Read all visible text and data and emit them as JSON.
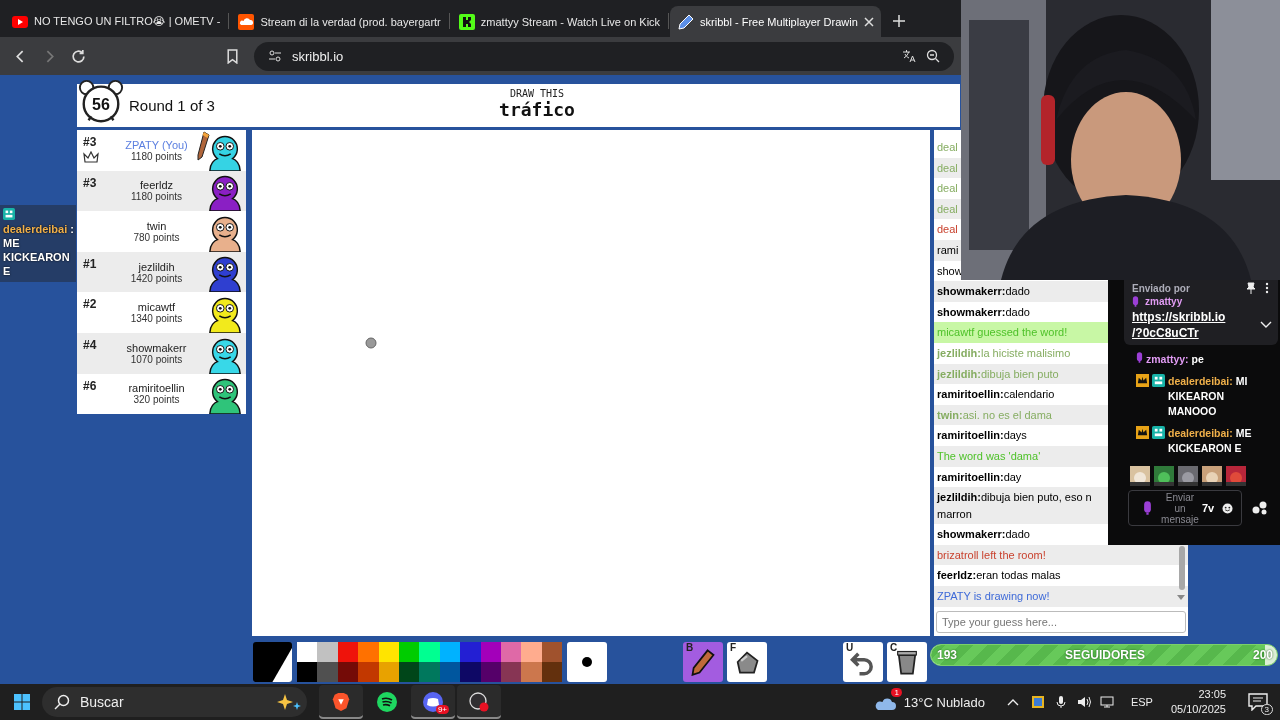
{
  "browser": {
    "tabs": [
      {
        "title": "NO TENGO UN FILTRO😭 | OMETV -",
        "kind": "video",
        "selected": false
      },
      {
        "title": "Stream di la verdad (prod. bayergartr",
        "kind": "audio",
        "selected": false
      },
      {
        "title": "zmattyy Stream - Watch Live on Kick",
        "kind": "stream",
        "selected": false
      },
      {
        "title": "skribbl - Free Multiplayer Drawin",
        "kind": "drawing",
        "selected": true
      }
    ],
    "forward_disabled": true,
    "url": "skribbl.io"
  },
  "game": {
    "timer": "56",
    "round": "Round 1 of 3",
    "prompt_label": "DRAW THIS",
    "word": "tráfico"
  },
  "players": [
    {
      "rank": "#3",
      "name": "ZPATY (You)",
      "points": "1180 points",
      "is_you": true,
      "owner": true,
      "drawing": true,
      "color": "#35d3e4"
    },
    {
      "rank": "#3",
      "name": "feerldz",
      "points": "1180 points",
      "is_you": false,
      "owner": false,
      "drawing": false,
      "color": "#8a1fc4"
    },
    {
      "name": "twin",
      "points": "780 points",
      "is_you": false,
      "owner": false,
      "drawing": false,
      "color": "#e8b08c"
    },
    {
      "rank": "#1",
      "name": "jezlildih",
      "points": "1420 points",
      "is_you": false,
      "owner": false,
      "drawing": false,
      "color": "#2f3fd0"
    },
    {
      "rank": "#2",
      "name": "micawtf",
      "points": "1340 points",
      "is_you": false,
      "owner": false,
      "drawing": false,
      "color": "#f2ea1c"
    },
    {
      "rank": "#4",
      "name": "showmakerr",
      "points": "1070 points",
      "is_you": false,
      "owner": false,
      "drawing": false,
      "color": "#38d8e8"
    },
    {
      "rank": "#6",
      "name": "ramiritoellin",
      "points": "320 points",
      "is_you": false,
      "owner": false,
      "drawing": false,
      "color": "#2fc47a"
    }
  ],
  "chat": {
    "messages": [
      {
        "text": "deal",
        "kind": "guessed",
        "highlight": false
      },
      {
        "text": "deal",
        "kind": "guessed",
        "highlight": false
      },
      {
        "text": "deal",
        "kind": "guessed",
        "highlight": false
      },
      {
        "text": "deal",
        "kind": "guessed",
        "highlight": false
      },
      {
        "text": "deal",
        "kind": "bad",
        "highlight": false
      },
      {
        "text": "rami",
        "kind": "normal",
        "highlight": false
      },
      {
        "text": "show",
        "kind": "normal",
        "highlight": false
      },
      {
        "name": "showmakerr:",
        "text": "dado",
        "kind": "normal",
        "highlight": false
      },
      {
        "name": "showmakerr:",
        "text": "dado",
        "kind": "normal",
        "highlight": false
      },
      {
        "text": "micawtf guessed the word!",
        "kind": "good",
        "highlight": true
      },
      {
        "name": "jezlildih:",
        "text": "la hiciste malisimo",
        "kind": "guessed",
        "highlight": false
      },
      {
        "name": "jezlildih:",
        "text": "dibuja bien puto",
        "kind": "guessed",
        "highlight": false
      },
      {
        "name": "ramiritoellin:",
        "text": "calendario",
        "kind": "normal",
        "highlight": false
      },
      {
        "name": "twin:",
        "text": "asi. no es el dama",
        "kind": "guessed",
        "highlight": false
      },
      {
        "name": "ramiritoellin:",
        "text": "days",
        "kind": "normal",
        "highlight": false
      },
      {
        "text": "The word was 'dama'",
        "kind": "good",
        "highlight": false
      },
      {
        "name": "ramiritoellin:",
        "text": "day",
        "kind": "normal",
        "highlight": false
      },
      {
        "name": "jezlildih:",
        "text": "dibuja bien puto, eso n",
        "continuation": "marron",
        "kind": "normal",
        "highlight": false
      },
      {
        "name": "showmakerr:",
        "text": "dado",
        "kind": "normal",
        "highlight": false
      },
      {
        "text": "brizatroll left the room!",
        "kind": "bad",
        "highlight": false
      },
      {
        "name": "feerldz:",
        "text": "eran todas malas",
        "kind": "normal",
        "highlight": false
      },
      {
        "text": "ZPATY is drawing now!",
        "kind": "info",
        "highlight": false
      }
    ],
    "placeholder": "Type your guess here..."
  },
  "palette": {
    "current": {
      "color": "#000000"
    },
    "colors": [
      {
        "color": "#ffffff"
      },
      {
        "color": "#c1c1c1"
      },
      {
        "color": "#ef130b"
      },
      {
        "color": "#ff7100"
      },
      {
        "color": "#ffe400"
      },
      {
        "color": "#00cc00"
      },
      {
        "color": "#00ff91"
      },
      {
        "color": "#00b2ff"
      },
      {
        "color": "#231fd3"
      },
      {
        "color": "#a300ba"
      },
      {
        "color": "#df69a7"
      },
      {
        "color": "#ffac8e"
      },
      {
        "color": "#a0522d"
      },
      {
        "color": "#000000"
      },
      {
        "color": "#505050"
      },
      {
        "color": "#740b07"
      },
      {
        "color": "#c23800"
      },
      {
        "color": "#e8a200"
      },
      {
        "color": "#004619"
      },
      {
        "color": "#00785d"
      },
      {
        "color": "#00569e"
      },
      {
        "color": "#0e0865"
      },
      {
        "color": "#550069"
      },
      {
        "color": "#873554"
      },
      {
        "color": "#cc774d"
      },
      {
        "color": "#63300d"
      }
    ]
  },
  "tools": [
    {
      "key": "B",
      "kind": "pencil",
      "selected": true
    },
    {
      "key": "F",
      "kind": "fill",
      "selected": false
    },
    {
      "key": "U",
      "kind": "undo",
      "selected": false
    },
    {
      "key": "C",
      "kind": "clear",
      "selected": false
    }
  ],
  "overlay_message": {
    "user": "dealerdeibai",
    "text": ": ME KICKEARON E"
  },
  "stream_chat": {
    "pinned": {
      "header": "Enviado por",
      "user": "zmattyy",
      "color": "#e29cf5",
      "link_lines": [
        "https://skribbl.io",
        "/?0cC8uCTr"
      ]
    },
    "messages": [
      {
        "user": "zmattyy:",
        "text": "pe",
        "color": "#e29cf5",
        "badges": [
          {
            "kind": "mic"
          }
        ]
      },
      {
        "user": "dealerdeibai:",
        "text": "MI KIKEARON MANOOO",
        "color": "#f0b04a",
        "badges": [
          {
            "kind": "crown"
          },
          {
            "kind": "team"
          }
        ]
      },
      {
        "user": "dealerdeibai:",
        "text": "ME KICKEARON E",
        "color": "#f0b04a",
        "badges": [
          {
            "kind": "crown"
          },
          {
            "kind": "team"
          }
        ]
      }
    ],
    "input_placeholder": "Enviar un mensaje",
    "extension_label": "7v"
  },
  "follower_goal": {
    "current": "193",
    "label": "SEGUIDORES",
    "goal": "200",
    "level": 0.965
  },
  "taskbar": {
    "search_placeholder": "Buscar",
    "apps": [
      {
        "kind": "browser",
        "active": true
      },
      {
        "kind": "music",
        "active": false
      },
      {
        "kind": "chat",
        "active": true,
        "badge": "9+"
      },
      {
        "kind": "recorder",
        "active": true
      }
    ],
    "weather_badge": "1",
    "temperature": "13°C",
    "condition": "Nublado",
    "language": "ESP",
    "time": "23:05",
    "date": "05/10/2025",
    "notifications": "3"
  }
}
